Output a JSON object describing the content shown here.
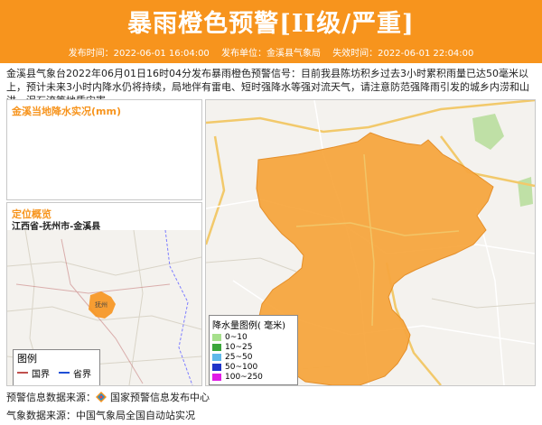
{
  "banner": {
    "title": "暴雨橙色预警[II级/严重]",
    "publish_time": "发布时间：2022-06-01 16:04:00",
    "publisher": "发布单位：金溪县气象局",
    "expire_time": "失效时间：2022-06-01 22:04:00"
  },
  "description": "金溪县气象台2022年06月01日16时04分发布暴雨橙色预警信号：目前我县陈坊积乡过去3小时累积雨量已达50毫米以上，预计未来3小时内降水仍将持续，局地伴有雷电、短时强降水等强对流天气，请注意防范强降雨引发的城乡内涝和山洪、泥石流等地质灾害。",
  "rain_panel": {
    "title": "金溪当地降水实况(mm)"
  },
  "location_panel": {
    "title": "定位概览",
    "region": "江西省-抚州市-金溪县",
    "legend_title": "图例",
    "legend_items": [
      {
        "label": "国界",
        "color": "#c0504d"
      },
      {
        "label": "省界",
        "color": "#1f4fd6"
      }
    ],
    "map_labels": [
      "抚州"
    ]
  },
  "map_panel": {
    "legend_title": "降水量图例( 毫米)",
    "legend_items": [
      {
        "label": "0~10",
        "color": "#a6e08c"
      },
      {
        "label": "10~25",
        "color": "#3aa63a"
      },
      {
        "label": "25~50",
        "color": "#5fb8ea"
      },
      {
        "label": "50~100",
        "color": "#1f34c9"
      },
      {
        "label": "100~250",
        "color": "#e01be6"
      }
    ],
    "warning_area_color": "#f7a740"
  },
  "footer": {
    "source1": "预警信息数据来源：",
    "source1_name": "国家预警信息发布中心",
    "source2": "气象数据来源：中国气象局全国自动站实况"
  }
}
